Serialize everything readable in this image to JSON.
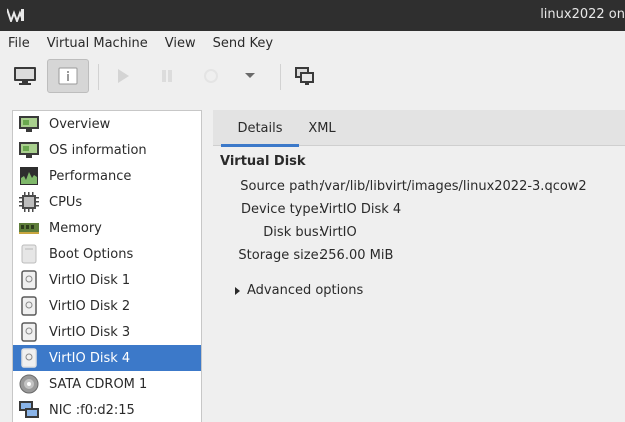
{
  "window": {
    "title": "linux2022 on"
  },
  "menu": [
    "File",
    "Virtual Machine",
    "View",
    "Send Key"
  ],
  "toolbar": {
    "buttons": [
      "console-monitor-icon",
      "details-info-icon",
      "run-play-icon",
      "pause-icon",
      "shutdown-icon",
      "dropdown-arrow-icon",
      "snapshots-icon"
    ],
    "active": "details-info-icon"
  },
  "sidebar": {
    "items": [
      {
        "label": "Overview",
        "icon": "overview-monitor-icon"
      },
      {
        "label": "OS information",
        "icon": "os-monitor-icon"
      },
      {
        "label": "Performance",
        "icon": "performance-chart-icon"
      },
      {
        "label": "CPUs",
        "icon": "cpu-chip-icon"
      },
      {
        "label": "Memory",
        "icon": "memory-ram-icon"
      },
      {
        "label": "Boot Options",
        "icon": "boot-options-icon"
      },
      {
        "label": "VirtIO Disk 1",
        "icon": "disk-icon"
      },
      {
        "label": "VirtIO Disk 2",
        "icon": "disk-icon"
      },
      {
        "label": "VirtIO Disk 3",
        "icon": "disk-icon"
      },
      {
        "label": "VirtIO Disk 4",
        "icon": "disk-icon"
      },
      {
        "label": "SATA CDROM 1",
        "icon": "cdrom-icon"
      },
      {
        "label": "NIC :f0:d2:15",
        "icon": "nic-network-icon"
      }
    ],
    "selected": "VirtIO Disk 4"
  },
  "tabs": {
    "details": "Details",
    "xml": "XML",
    "active": "Details"
  },
  "disk": {
    "section_title": "Virtual Disk",
    "rows": [
      {
        "label": "Source path:",
        "value": "/var/lib/libvirt/images/linux2022-3.qcow2"
      },
      {
        "label": "Device type:",
        "value": "VirtIO Disk 4"
      },
      {
        "label": "Disk bus:",
        "value": "VirtIO"
      },
      {
        "label": "Storage size:",
        "value": "256.00 MiB"
      }
    ],
    "advanced_label": "Advanced options"
  },
  "colors": {
    "selection": "#3c79c9",
    "titlebar": "#2f2f2f"
  }
}
